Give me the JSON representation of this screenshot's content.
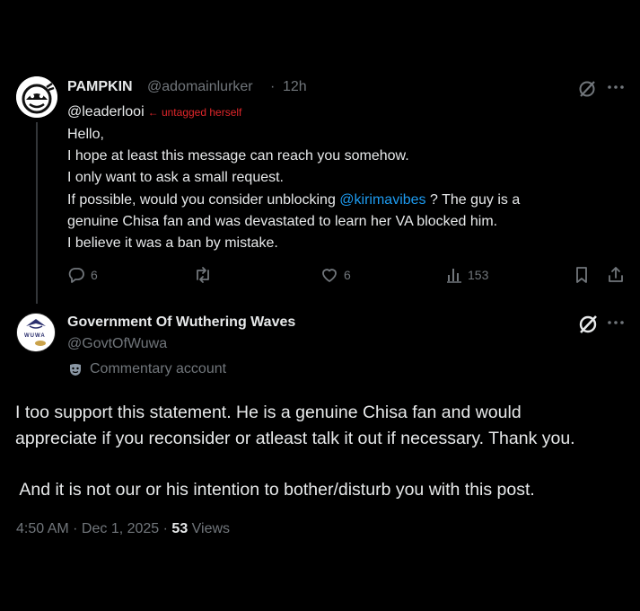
{
  "parent": {
    "author_name": "PAMPKIN",
    "handle": "@adomainlurker",
    "separator": "·",
    "time": "12h",
    "mention": "@leaderlooi",
    "untag_note": "← untagged herself",
    "lines": [
      "Hello,",
      "I hope at least this message can reach you somehow.",
      "I only want to ask a small request."
    ],
    "line4_pre": "If possible, would you consider unblocking ",
    "line4_link": "@kirimavibes",
    "line4_post": " ? The guy is a",
    "line5": "genuine Chisa fan and was devastated to learn her VA blocked him.",
    "line6": "I believe it was a ban by mistake.",
    "replies": "6",
    "likes": "6",
    "views": "153"
  },
  "reply": {
    "author_name": "Government Of Wuthering Waves",
    "handle": "@GovtOfWuwa",
    "label": "Commentary account",
    "avatar_text": "WUWA",
    "lines": [
      "I too support this statement. He is a genuine Chisa fan and would",
      "appreciate if you reconsider or atleast talk it out if necessary. Thank you.",
      "",
      " And it is not our or his intention to bother/disturb you with this post."
    ],
    "timestamp": "4:50 AM · Dec 1, 2025 · ",
    "views_count": "53",
    "views_label": " Views"
  }
}
